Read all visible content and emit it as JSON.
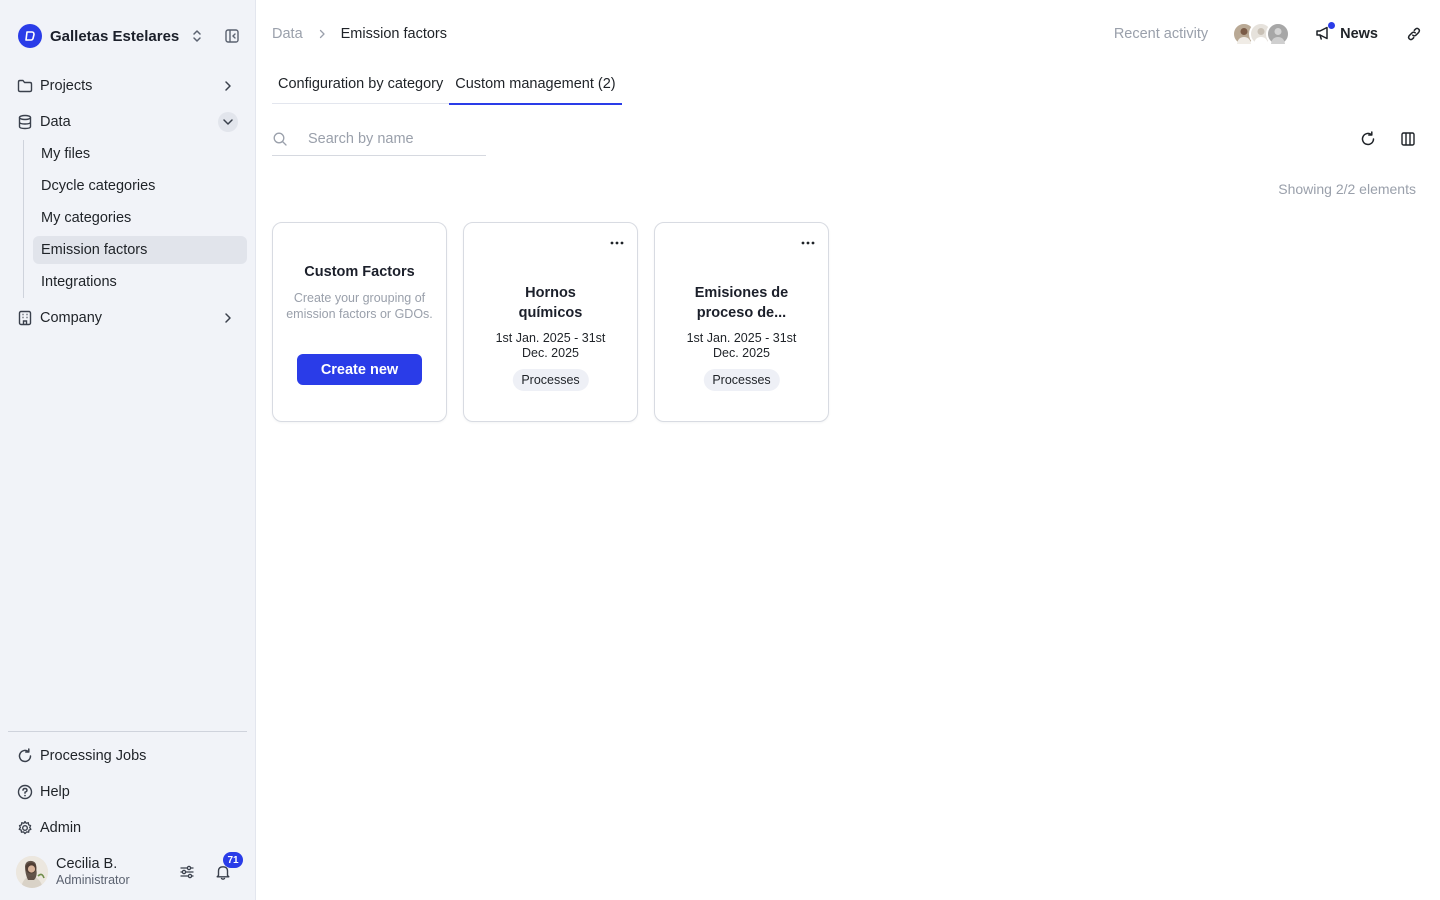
{
  "sidebar": {
    "org_name": "Galletas Estelares",
    "items": {
      "projects": "Projects",
      "data": "Data",
      "company": "Company"
    },
    "data_sub": [
      "My files",
      "Dcycle categories",
      "My categories",
      "Emission factors",
      "Integrations"
    ],
    "bottom": {
      "processing_jobs": "Processing Jobs",
      "help": "Help",
      "admin": "Admin"
    },
    "user": {
      "name": "Cecilia B.",
      "role": "Administrator",
      "notifications": "71"
    }
  },
  "breadcrumb": {
    "root": "Data",
    "current": "Emission factors"
  },
  "topbar": {
    "recent_activity": "Recent activity",
    "news": "News"
  },
  "tabs": [
    "Configuration by category",
    "Custom management (2)"
  ],
  "active_tab": 1,
  "search": {
    "placeholder": "Search by name",
    "value": ""
  },
  "counter": "Showing 2/2 elements",
  "create_card": {
    "title": "Custom Factors",
    "description": "Create your grouping of emission factors or GDOs.",
    "button": "Create new"
  },
  "cards": [
    {
      "title": "Hornos químicos",
      "dates": "1st Jan. 2025 - 31st Dec. 2025",
      "tag": "Processes"
    },
    {
      "title": "Emisiones de proceso de...",
      "dates": "1st Jan. 2025 - 31st Dec. 2025",
      "tag": "Processes"
    }
  ],
  "colors": {
    "accent": "#2a3ce8",
    "sidebar_bg": "#f1f3f8",
    "muted_text": "#9aa0ab"
  }
}
